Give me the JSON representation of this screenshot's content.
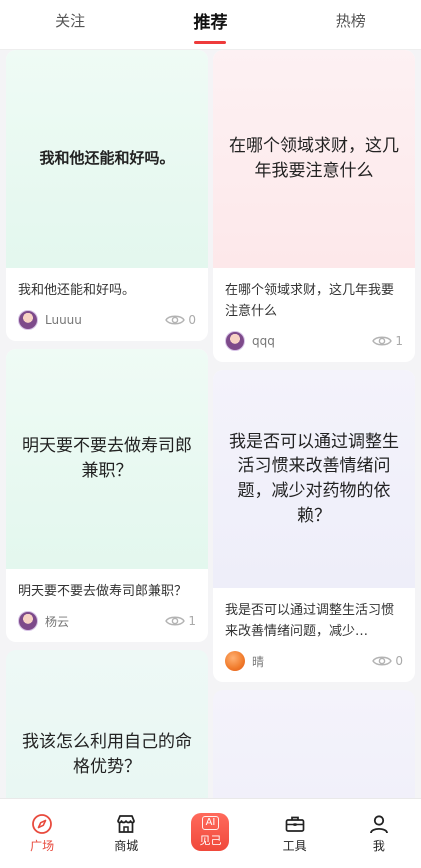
{
  "tabs": [
    {
      "label": "关注"
    },
    {
      "label": "推荐"
    },
    {
      "label": "热榜"
    }
  ],
  "feed": {
    "left": [
      {
        "cover": "我和他还能和好吗。",
        "desc": "我和他还能和好吗。",
        "user": "Luuuu",
        "views": "0",
        "avatar": "girl"
      },
      {
        "cover": "明天要不要去做寿司郎兼职？",
        "desc": "明天要不要去做寿司郎兼职？",
        "user": "杨云",
        "views": "1",
        "avatar": "girl"
      },
      {
        "cover": "我该怎么利用自己的命格优势？"
      }
    ],
    "right": [
      {
        "cover": "在哪个领域求财，这几年我要注意什么",
        "desc": "在哪个领域求财，这几年我要注意什么",
        "user": "qqq",
        "views": "1",
        "avatar": "girl"
      },
      {
        "cover": "我是否可以通过调整生活习惯来改善情绪问题，减少对药物的依赖？",
        "desc": "我是否可以通过调整生活习惯来改善情绪问题，减少…",
        "user": "晴",
        "views": "0",
        "avatar": "orange"
      }
    ]
  },
  "bottom_nav": [
    {
      "label": "广场",
      "icon": "compass-icon"
    },
    {
      "label": "商城",
      "icon": "store-icon"
    },
    {
      "label": "见己",
      "icon": "ai-icon",
      "badge": "AI"
    },
    {
      "label": "工具",
      "icon": "toolbox-icon"
    },
    {
      "label": "我",
      "icon": "user-icon"
    }
  ],
  "colors": {
    "accent": "#e84a3d",
    "tab_indicator": "#ee3b3b"
  }
}
